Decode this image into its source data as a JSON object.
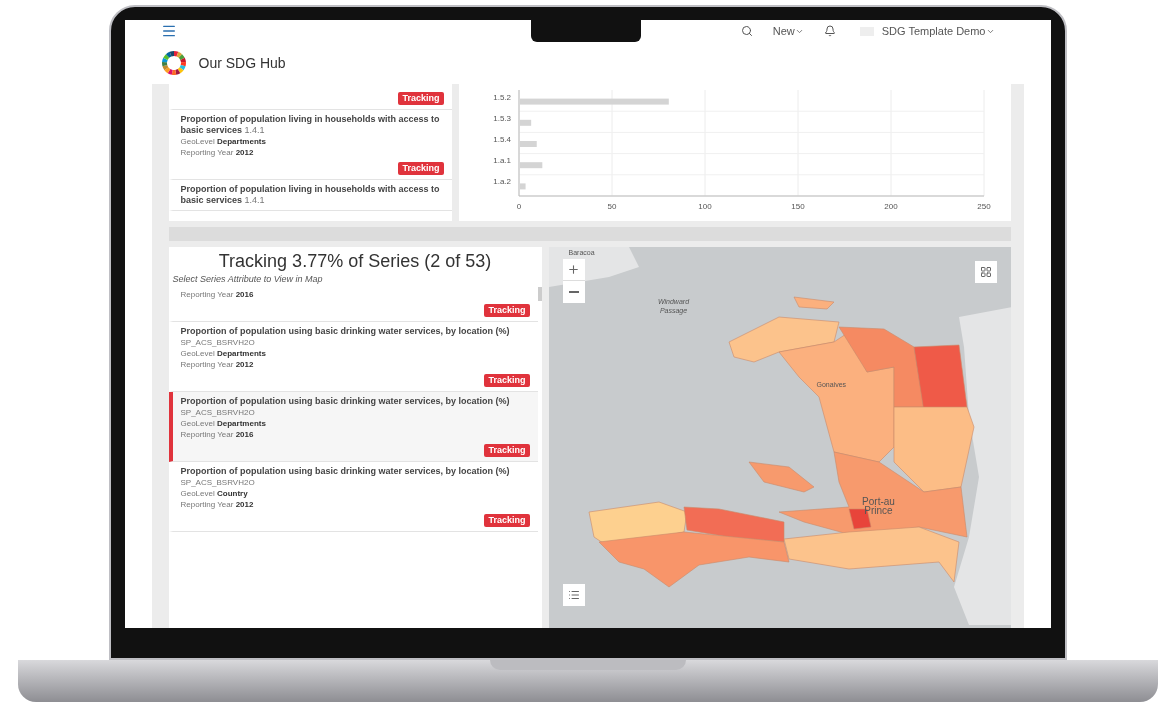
{
  "header": {
    "new_label": "New",
    "user_name": "SDG Template Demo",
    "app_title": "Our SDG Hub"
  },
  "top_list": {
    "items": [
      {
        "badge": "Tracking",
        "selected": false
      },
      {
        "title": "Proportion of population living in households with access to basic services",
        "code": "1.4.1",
        "geolevel_label": "GeoLevel",
        "geolevel": "Departments",
        "year_label": "Reporting Year",
        "year": "2012",
        "badge": "Tracking",
        "selected": false
      },
      {
        "title": "Proportion of population living in households with access to basic services",
        "code": "1.4.1",
        "selected": false
      }
    ]
  },
  "indicator_chart": {
    "chart_data": {
      "type": "bar",
      "orientation": "horizontal",
      "categories": [
        "1.5.2",
        "1.5.3",
        "1.5.4",
        "1.a.1",
        "1.a.2"
      ],
      "values": [
        80,
        6,
        9,
        12,
        3
      ],
      "grid": true,
      "xlim": [
        0,
        250
      ],
      "xticks": [
        0,
        50,
        100,
        150,
        200,
        250
      ]
    }
  },
  "series_panel": {
    "title": "Tracking 3.77% of Series (2 of 53)",
    "subtitle": "Select Series Attribute to View in Map",
    "items": [
      {
        "year_label": "Reporting Year",
        "year": "2016",
        "badge": "Tracking",
        "selected": false
      },
      {
        "title": "Proportion of population using basic drinking water services, by location (%)",
        "code": "SP_ACS_BSRVH2O",
        "geolevel_label": "GeoLevel",
        "geolevel": "Departments",
        "year_label": "Reporting Year",
        "year": "2012",
        "badge": "Tracking",
        "selected": false
      },
      {
        "title": "Proportion of population using basic drinking water services, by location (%)",
        "code": "SP_ACS_BSRVH2O",
        "geolevel_label": "GeoLevel",
        "geolevel": "Departments",
        "year_label": "Reporting Year",
        "year": "2016",
        "badge": "Tracking",
        "selected": true
      },
      {
        "title": "Proportion of population using basic drinking water services, by location (%)",
        "code": "SP_ACS_BSRVH2O",
        "geolevel_label": "GeoLevel",
        "geolevel": "Country",
        "year_label": "Reporting Year",
        "year": "2012",
        "badge": "Tracking",
        "selected": false
      }
    ]
  },
  "map": {
    "labels": [
      {
        "text": "Baracoa"
      },
      {
        "text": "Windward Passage"
      },
      {
        "text": "Gonaives"
      },
      {
        "text": "Port-au Prince"
      }
    ]
  }
}
